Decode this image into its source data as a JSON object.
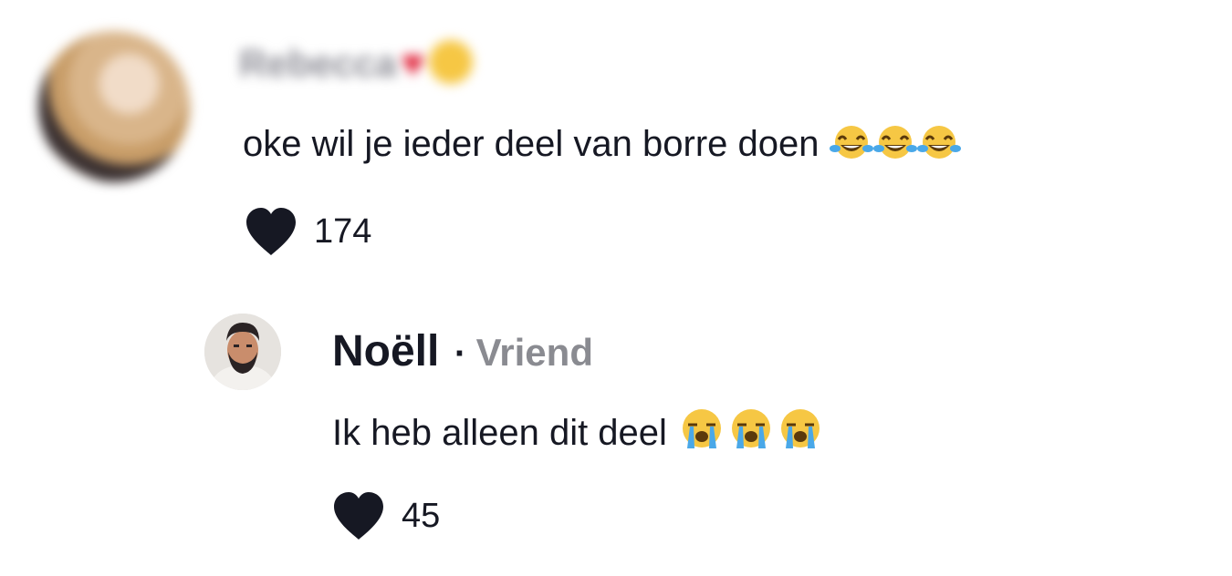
{
  "comments": [
    {
      "author": "Rebecca",
      "author_blurred": true,
      "text": "oke wil je ieder deel van borre doen",
      "emoji": [
        "face-with-tears-of-joy",
        "face-with-tears-of-joy",
        "face-with-tears-of-joy"
      ],
      "likes": "174"
    }
  ],
  "reply": {
    "author": "Noëll",
    "separator": "·",
    "badge": "Vriend",
    "text": "Ik heb alleen dit deel",
    "emoji": [
      "loudly-crying-face",
      "loudly-crying-face",
      "loudly-crying-face"
    ],
    "likes": "45"
  },
  "colors": {
    "text": "#161823",
    "badge": "#8a8b91",
    "background": "#ffffff"
  }
}
